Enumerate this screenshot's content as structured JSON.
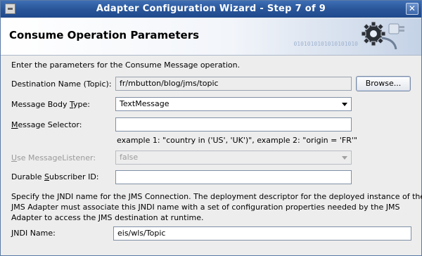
{
  "window": {
    "title": "Adapter Configuration Wizard - Step 7 of 9",
    "close_glyph": "✕"
  },
  "header": {
    "title": "Consume Operation Parameters",
    "decoration_text": "0101010101010101010"
  },
  "intro": "Enter the parameters for the Consume Message operation.",
  "fields": {
    "destination": {
      "label": "Destination Name (Topic):",
      "value": "fr/mbutton/blog/jms/topic",
      "browse_label": "Browse..."
    },
    "body_type": {
      "label_pre": "Message Body ",
      "label_u": "T",
      "label_post": "ype:",
      "value": "TextMessage"
    },
    "selector": {
      "label_u": "M",
      "label_post": "essage Selector:",
      "value": ""
    },
    "example": "example 1: \"country in ('US', 'UK')\", example 2: \"origin = 'FR'\"",
    "listener": {
      "label_u": "U",
      "label_post": "se MessageListener:",
      "value": "false"
    },
    "subscriber": {
      "label_pre": "Durable ",
      "label_u": "S",
      "label_post": "ubscriber ID:",
      "value": ""
    },
    "jndi_desc_line1": "Specify the JNDI name for the JMS Connection.  The deployment descriptor for the deployed instance of the",
    "jndi_desc_line2": "JMS Adapter must associate this JNDI name with a set of configuration properties needed by the JMS",
    "jndi_desc_line3": "Adapter to access the JMS destination at runtime.",
    "jndi": {
      "label_u": "J",
      "label_post": "NDI Name:",
      "value": "eis/wls/Topic"
    }
  },
  "colors": {
    "titlebar": "#2a5699",
    "background": "#ededed"
  },
  "icons": {
    "title": "window-menu-icon",
    "header": "gear-plug-icon"
  }
}
